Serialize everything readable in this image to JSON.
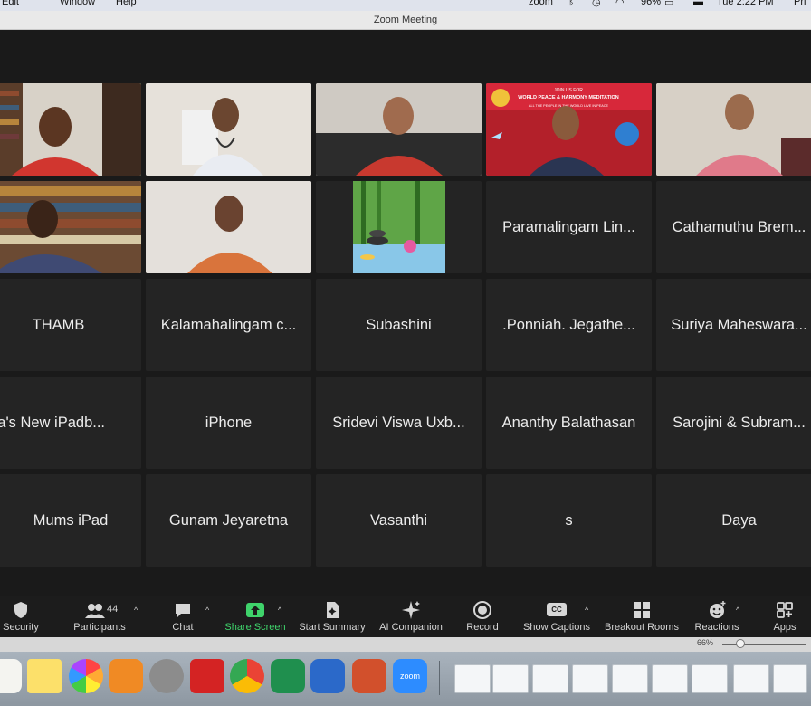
{
  "menubar": {
    "left_items": [
      "Edit",
      "Window",
      "Help"
    ],
    "app_label": "zoom",
    "battery": "96%",
    "clock": "Tue 2:22 PM",
    "right_cut": "Pri"
  },
  "window": {
    "title": "Zoom Meeting"
  },
  "video_tiles": [
    {
      "id": "v1",
      "kind": "video",
      "active": true,
      "desc": "man-red-shirt-bookshelf"
    },
    {
      "id": "v2",
      "kind": "video",
      "desc": "woman-stethoscope"
    },
    {
      "id": "v3",
      "kind": "video",
      "desc": "woman-red-dress-sofa"
    },
    {
      "id": "v4",
      "kind": "video",
      "desc": "man-meditation-banner"
    },
    {
      "id": "v5",
      "kind": "video",
      "desc": "elderly-woman-pink"
    },
    {
      "id": "v6",
      "kind": "video",
      "desc": "man-glasses-bookshelf"
    },
    {
      "id": "v7",
      "kind": "video",
      "desc": "woman-orange-top"
    },
    {
      "id": "v8",
      "kind": "image",
      "desc": "zen-stones-bamboo"
    }
  ],
  "name_tiles": [
    "Paramalingam Lin...",
    "Cathamuthu Brem...",
    "THAMB",
    "Kalamahalingam c...",
    "Subashini",
    ".Ponniah. Jegathe...",
    "Suriya Maheswara...",
    "aya's New iPadb...",
    "iPhone",
    "Sridevi Viswa Uxb...",
    "Ananthy Balathasan",
    "Sarojini & Subram...",
    "Mums iPad",
    "Gunam Jeyaretna",
    "Vasanthi",
    "s",
    "Daya"
  ],
  "banner_lines": {
    "top": "JOIN US FOR",
    "headline": "WORLD PEACE & HARMONY MEDITATION",
    "bottom": "ALL THE PEOPLE IN THE WORLD LIVE IN PEACE"
  },
  "toolbar": {
    "participant_count": "44",
    "buttons": [
      {
        "key": "security",
        "label": "Security",
        "icon": "shield-icon"
      },
      {
        "key": "participants",
        "label": "Participants",
        "icon": "participants-icon"
      },
      {
        "key": "chat",
        "label": "Chat",
        "icon": "chat-icon"
      },
      {
        "key": "share",
        "label": "Share Screen",
        "icon": "share-screen-icon"
      },
      {
        "key": "summary",
        "label": "Start Summary",
        "icon": "summary-icon"
      },
      {
        "key": "ai",
        "label": "AI Companion",
        "icon": "sparkle-icon"
      },
      {
        "key": "record",
        "label": "Record",
        "icon": "record-icon"
      },
      {
        "key": "captions",
        "label": "Show Captions",
        "icon": "cc-icon"
      },
      {
        "key": "breakout",
        "label": "Breakout Rooms",
        "icon": "grid-icon"
      },
      {
        "key": "reactions",
        "label": "Reactions",
        "icon": "reaction-icon"
      },
      {
        "key": "apps",
        "label": "Apps",
        "icon": "apps-icon"
      }
    ],
    "captions_badge": "CC"
  },
  "zoom_level": "66%",
  "zoom_slider_value": 0.16,
  "colors": {
    "active_speaker": "#35c24a",
    "share_green": "#3fd36b",
    "tile_bg": "#242424"
  },
  "dock": {
    "zoom_app_label": "zoom",
    "apps": [
      "notes-app-icon",
      "stickies-app-icon",
      "photos-app-icon",
      "books-app-icon",
      "system-settings-app-icon",
      "acrobat-app-icon",
      "chrome-app-icon",
      "excel-app-icon",
      "word-app-icon",
      "powerpoint-app-icon",
      "zoom-app-icon"
    ]
  }
}
